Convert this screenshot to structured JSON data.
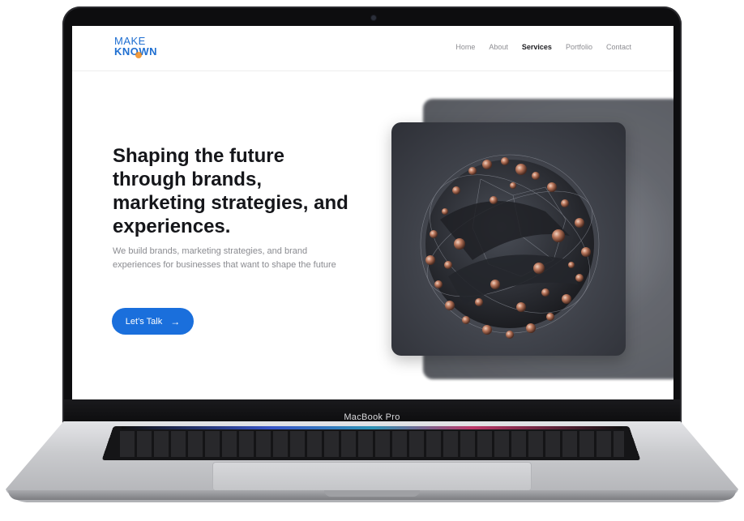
{
  "device": {
    "model_label": "MacBook Pro"
  },
  "site": {
    "logo": {
      "line1": "MAKE",
      "line2": "KNOWN"
    },
    "nav": [
      {
        "label": "Home",
        "active": false
      },
      {
        "label": "About",
        "active": false
      },
      {
        "label": "Services",
        "active": true
      },
      {
        "label": "Portfolio",
        "active": false
      },
      {
        "label": "Contact",
        "active": false
      }
    ],
    "hero": {
      "title": "Shaping the future through brands, marketing strategies, and experiences.",
      "subtitle": "We build brands, marketing strategies, and brand experiences for businesses that want to shape the future",
      "cta_label": "Let’s Talk",
      "cta_icon": "arrow-right-icon"
    },
    "colors": {
      "accent": "#1a6fdc",
      "logo": "#1f6fd1",
      "logo_dot": "#f28c1c",
      "heading": "#15161a",
      "muted": "#8a8b90"
    }
  }
}
